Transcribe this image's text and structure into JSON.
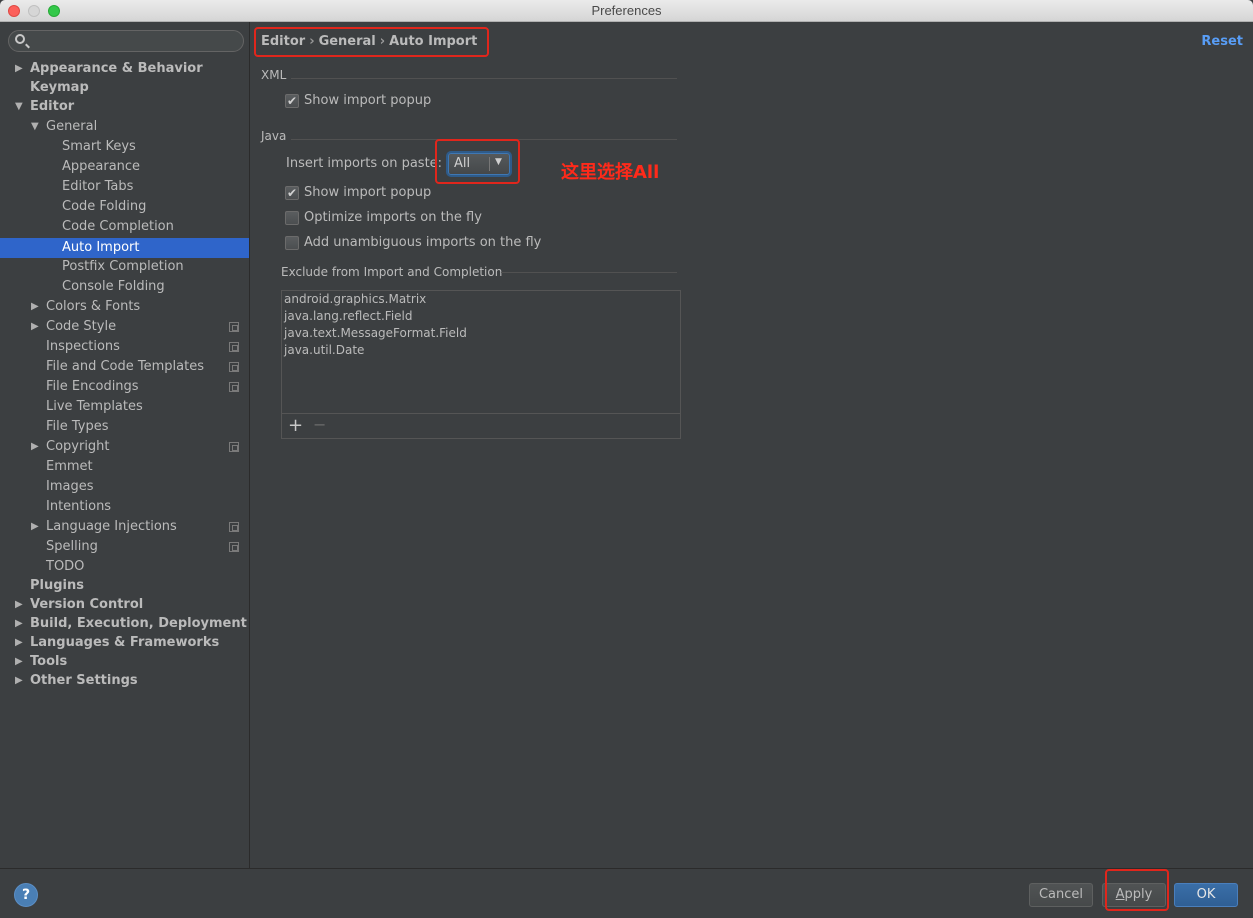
{
  "window": {
    "title": "Preferences"
  },
  "search": {
    "placeholder": ""
  },
  "sidebar": {
    "items": [
      {
        "label": "Appearance & Behavior"
      },
      {
        "label": "Keymap"
      },
      {
        "label": "Editor"
      },
      {
        "label": "General"
      },
      {
        "label": "Smart Keys"
      },
      {
        "label": "Appearance"
      },
      {
        "label": "Editor Tabs"
      },
      {
        "label": "Code Folding"
      },
      {
        "label": "Code Completion"
      },
      {
        "label": "Auto Import"
      },
      {
        "label": "Postfix Completion"
      },
      {
        "label": "Console Folding"
      },
      {
        "label": "Colors & Fonts"
      },
      {
        "label": "Code Style"
      },
      {
        "label": "Inspections"
      },
      {
        "label": "File and Code Templates"
      },
      {
        "label": "File Encodings"
      },
      {
        "label": "Live Templates"
      },
      {
        "label": "File Types"
      },
      {
        "label": "Copyright"
      },
      {
        "label": "Emmet"
      },
      {
        "label": "Images"
      },
      {
        "label": "Intentions"
      },
      {
        "label": "Language Injections"
      },
      {
        "label": "Spelling"
      },
      {
        "label": "TODO"
      },
      {
        "label": "Plugins"
      },
      {
        "label": "Version Control"
      },
      {
        "label": "Build, Execution, Deployment"
      },
      {
        "label": "Languages & Frameworks"
      },
      {
        "label": "Tools"
      },
      {
        "label": "Other Settings"
      }
    ]
  },
  "breadcrumb": {
    "part1": "Editor",
    "part2": "General",
    "part3": "Auto Import",
    "separator": "›"
  },
  "reset_label": "Reset",
  "xml": {
    "section_label": "XML",
    "show_import_popup": {
      "label": "Show import popup",
      "checked": true
    }
  },
  "java": {
    "section_label": "Java",
    "insert_imports_label": "Insert imports on paste:",
    "insert_imports_value": "All",
    "show_import_popup": {
      "label": "Show import popup",
      "checked": true
    },
    "optimize_imports": {
      "label": "Optimize imports on the fly",
      "checked": false
    },
    "add_unambiguous": {
      "label": "Add unambiguous imports on the fly",
      "checked": false
    }
  },
  "annotation": "这里选择All",
  "exclude": {
    "section_label": "Exclude from Import and Completion",
    "items": [
      "android.graphics.Matrix",
      "java.lang.reflect.Field",
      "java.text.MessageFormat.Field",
      "java.util.Date"
    ],
    "add_label": "+",
    "remove_label": "−"
  },
  "footer": {
    "help_label": "?",
    "cancel_label": "Cancel",
    "apply_first": "A",
    "apply_rest": "pply",
    "ok_label": "OK"
  },
  "colors": {
    "selection": "#2f65ca",
    "annotation_red": "#e0261c",
    "link": "#589df6"
  }
}
